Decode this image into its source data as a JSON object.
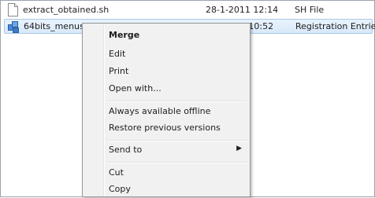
{
  "files": [
    {
      "name": "extract_obtained.sh",
      "date": "28-1-2011 12:14",
      "type": "SH File",
      "icon": "generic-file-icon"
    },
    {
      "name": "64bits_menus.reg",
      "date": "2-2-2011 10:52",
      "type": "Registration Entries",
      "icon": "registry-file-icon",
      "selected": true
    }
  ],
  "context_menu": {
    "items": [
      {
        "label": "Merge",
        "bold": true
      },
      {
        "label": "Edit"
      },
      {
        "label": "Print"
      },
      {
        "label": "Open with..."
      },
      {
        "label": "Always available offline"
      },
      {
        "label": "Restore previous versions"
      },
      {
        "label": "Send to",
        "submenu": true
      },
      {
        "label": "Cut"
      },
      {
        "label": "Copy"
      }
    ],
    "submenu_arrow": "▶"
  }
}
